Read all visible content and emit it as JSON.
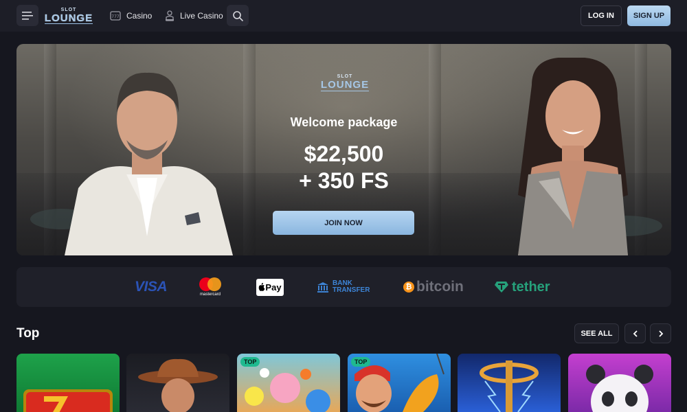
{
  "header": {
    "logo_top": "SLOT",
    "logo_bottom": "LOUNGE",
    "nav": [
      {
        "label": "Casino",
        "icon": "slot-machine-icon"
      },
      {
        "label": "Live Casino",
        "icon": "dealer-icon"
      }
    ],
    "login_label": "LOG IN",
    "signup_label": "SIGN UP"
  },
  "hero": {
    "logo_top": "SLOT",
    "logo_bottom": "LOUNGE",
    "title": "Welcome package",
    "amount": "$22,500",
    "free_spins": "+ 350 FS",
    "cta_label": "JOIN NOW"
  },
  "payments": {
    "visa": "VISA",
    "mastercard": "mastercard",
    "applepay": "Pay",
    "bank_line1": "BANK",
    "bank_line2": "TRANSFER",
    "bitcoin": "bitcoin",
    "tether": "tether"
  },
  "top_games": {
    "title": "Top",
    "see_all_label": "SEE ALL",
    "cards": [
      {
        "badge": "",
        "theme": "lucky-seven"
      },
      {
        "badge": "",
        "theme": "cowboy"
      },
      {
        "badge": "TOP",
        "theme": "candy-fruit"
      },
      {
        "badge": "TOP",
        "theme": "fisherman"
      },
      {
        "badge": "",
        "theme": "lightning-key"
      },
      {
        "badge": "",
        "theme": "panda"
      }
    ]
  },
  "colors": {
    "background": "#16171f",
    "header": "#1d1e27",
    "accent": "#9ec3e6",
    "badge": "#1fb98f"
  }
}
